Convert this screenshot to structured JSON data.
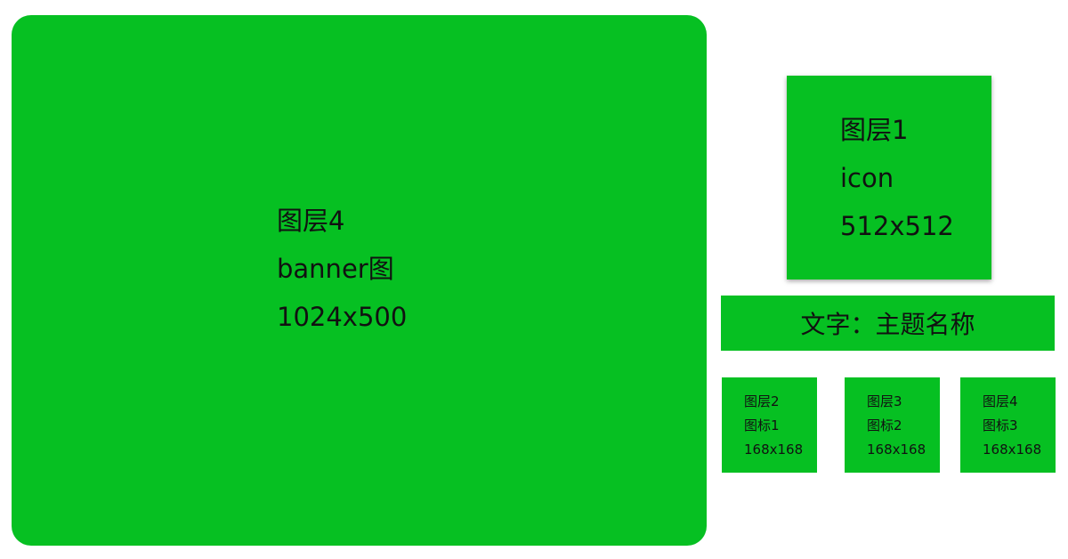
{
  "colors": {
    "block_fill": "#06c022",
    "background": "#ffffff",
    "text": "#111111"
  },
  "banner": {
    "lines": [
      "图层4",
      "banner图",
      "1024x500"
    ]
  },
  "icon_block": {
    "lines": [
      "图层1",
      "icon",
      "512x512"
    ]
  },
  "title_block": {
    "text": "文字：主题名称"
  },
  "small_blocks": [
    {
      "lines": [
        "图层2",
        "图标1",
        "168x168"
      ]
    },
    {
      "lines": [
        "图层3",
        "图标2",
        "168x168"
      ]
    },
    {
      "lines": [
        "图层4",
        "图标3",
        "168x168"
      ]
    }
  ]
}
